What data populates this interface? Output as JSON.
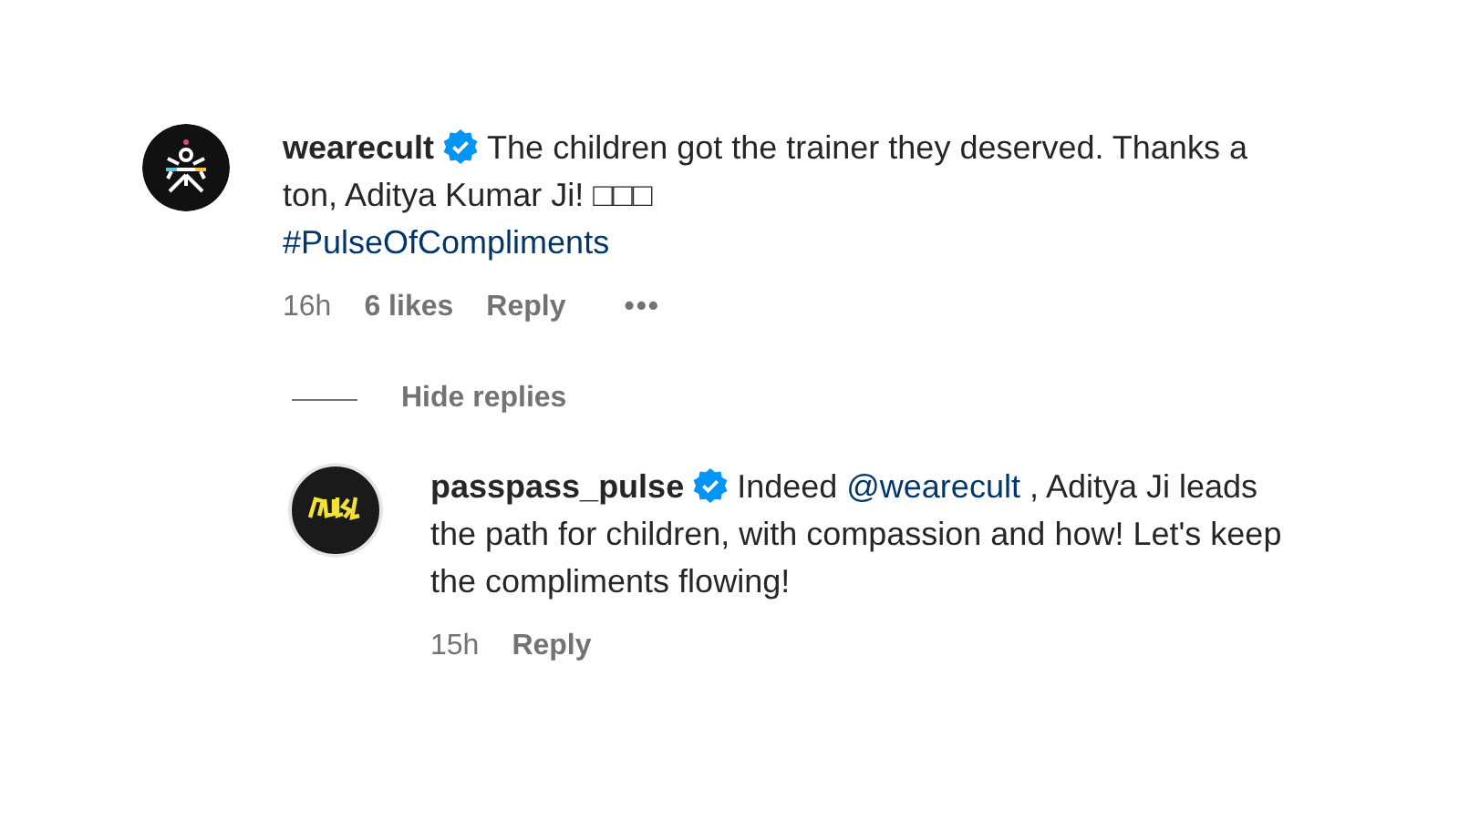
{
  "comment": {
    "username": "wearecult",
    "verified": true,
    "text": "The children got the trainer they deserved. Thanks a ton, Aditya Kumar Ji! □□□",
    "hashtag": "#PulseOfCompliments",
    "time": "16h",
    "likes": "6 likes",
    "reply": "Reply",
    "more": "•••"
  },
  "toggle": {
    "label": "Hide replies"
  },
  "reply": {
    "username": "passpass_pulse",
    "verified": true,
    "text_before": "Indeed ",
    "mention": "@wearecult",
    "text_after": " , Aditya Ji leads the path for children, with compassion and how! Let's keep the compliments flowing!",
    "time": "15h",
    "reply": "Reply"
  }
}
